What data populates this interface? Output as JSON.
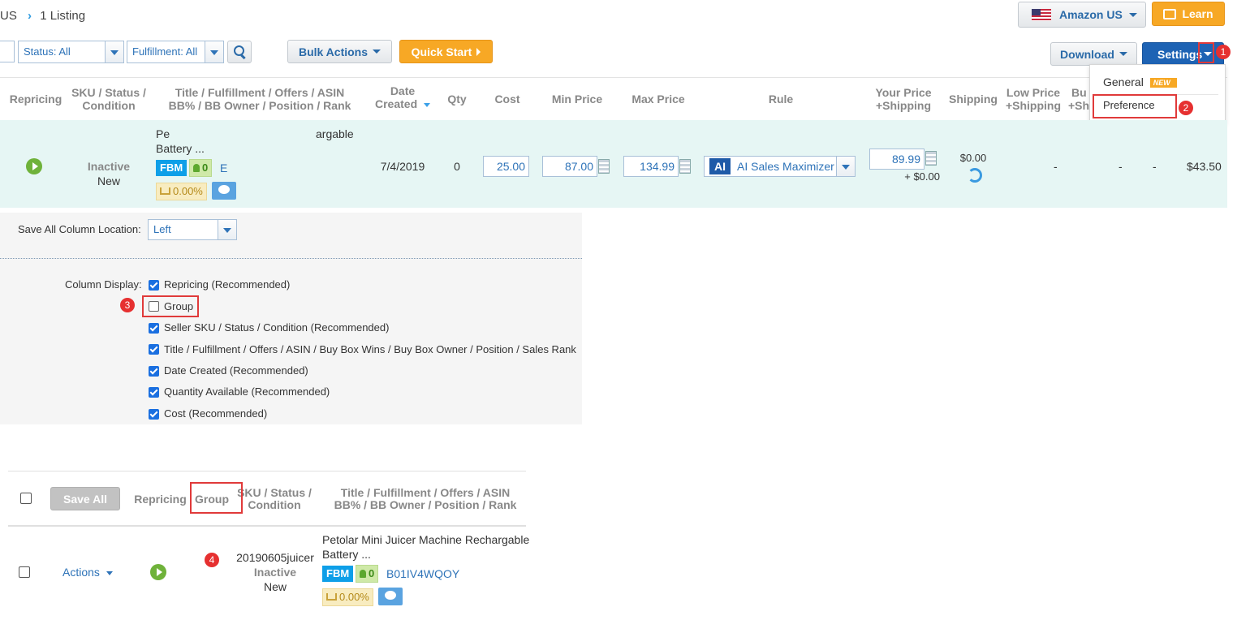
{
  "breadcrumb": {
    "region": "US",
    "current": "1 Listing"
  },
  "marketplace": {
    "label": "Amazon US"
  },
  "learn": {
    "label": "Learn"
  },
  "filters": {
    "status": "Status: All",
    "fulfillment": "Fulfillment: All"
  },
  "toolbar": {
    "bulk_actions": "Bulk Actions",
    "quick_start": "Quick Start",
    "download": "Download",
    "settings": "Settings"
  },
  "settings_menu": {
    "general": "General",
    "general_badge": "NEW",
    "preference": "Preference"
  },
  "table": {
    "headers": {
      "repricing": "Repricing",
      "sku1": "SKU / Status /",
      "sku2": "Condition",
      "title1": "Title / Fulfillment / Offers / ASIN",
      "title2": "BB% / BB Owner / Position / Rank",
      "date1": "Date",
      "date2": "Created",
      "qty": "Qty",
      "cost": "Cost",
      "min": "Min Price",
      "max": "Max Price",
      "rule": "Rule",
      "price1": "Your Price",
      "price2": "+Shipping",
      "shipping": "Shipping",
      "low1": "Low Price",
      "low2": "+Shipping",
      "bb1": "Bu",
      "bb2": "+Sh"
    },
    "row": {
      "status": "Inactive",
      "condition": "New",
      "title_frag_a": "Pe",
      "title_frag_b": "argable",
      "title_line2": "Battery ...",
      "fbm": "FBM",
      "offers": "0",
      "asin_frag": "E",
      "bb_percent": "0.00%",
      "date": "7/4/2019",
      "qty": "0",
      "cost": "25.00",
      "min": "87.00",
      "max": "134.99",
      "rule_badge": "AI",
      "rule": "AI Sales Maximizer",
      "your_price": "89.99",
      "your_shipping": "+ $0.00",
      "shipping": "$0.00",
      "low": "-",
      "bb": "-",
      "col_c": "-",
      "last": "$43.50"
    }
  },
  "preferences": {
    "save_location_label": "Save All Column Location:",
    "save_location_value": "Left",
    "column_display_label": "Column Display:",
    "options": [
      {
        "label": "Repricing (Recommended)",
        "checked": true
      },
      {
        "label": "Group",
        "checked": false
      },
      {
        "label": "Seller SKU / Status / Condition (Recommended)",
        "checked": true
      },
      {
        "label": "Title / Fulfillment / Offers / ASIN / Buy Box Wins / Buy Box Owner / Position / Sales Rank",
        "checked": true
      },
      {
        "label": "Date Created (Recommended)",
        "checked": true
      },
      {
        "label": "Quantity Available (Recommended)",
        "checked": true
      },
      {
        "label": "Cost (Recommended)",
        "checked": true
      }
    ]
  },
  "preview": {
    "save_all": "Save All",
    "headers": {
      "repricing": "Repricing",
      "group": "Group",
      "sku1": "SKU / Status /",
      "sku2": "Condition",
      "title1": "Title / Fulfillment / Offers / ASIN",
      "title2": "BB% / BB Owner / Position / Rank"
    },
    "row": {
      "actions": "Actions",
      "sku": "20190605juicer",
      "status": "Inactive",
      "condition": "New",
      "title1": "Petolar Mini Juicer Machine Rechargable",
      "title2": "Battery ...",
      "fbm": "FBM",
      "offers": "0",
      "asin": "B01IV4WQOY",
      "bb_percent": "0.00%"
    }
  },
  "annotations": [
    "1",
    "2",
    "3",
    "4"
  ],
  "colors": {
    "accent": "#1e63b4",
    "orange": "#f7a825",
    "row_highlight": "#e6f6f4",
    "annotation": "#e63030"
  }
}
